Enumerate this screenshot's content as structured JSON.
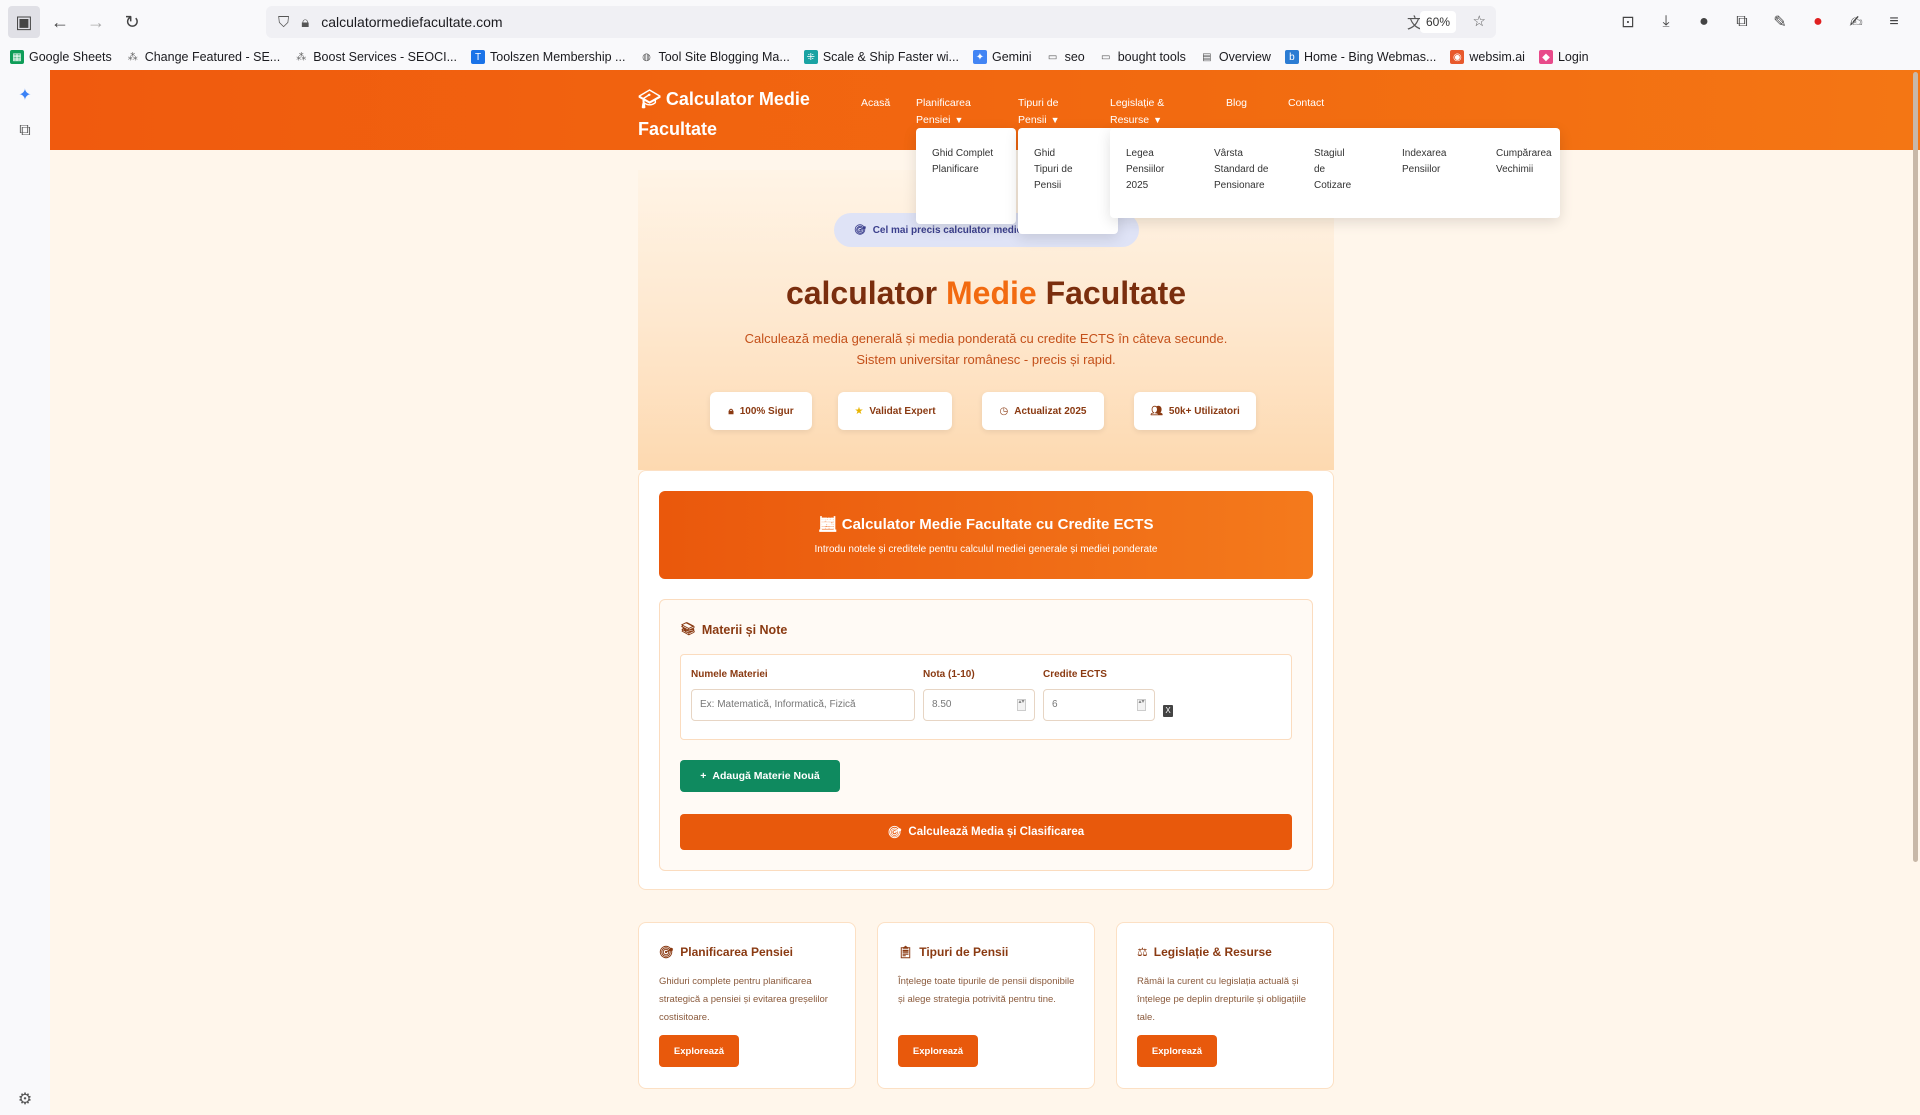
{
  "browser": {
    "url": "calculatormediefacultate.com",
    "zoom": "60%",
    "bookmarks": [
      {
        "label": "Google Sheets",
        "icon": "sheets-icon",
        "color": "#0f9d58"
      },
      {
        "label": "Change Featured - SE...",
        "icon": "network-icon",
        "color": "#666666"
      },
      {
        "label": "Boost Services - SEOCI...",
        "icon": "network-icon",
        "color": "#666666"
      },
      {
        "label": "Toolszen Membership ...",
        "icon": "toolszen-icon",
        "color": "#1a73e8"
      },
      {
        "label": "Tool Site Blogging Ma...",
        "icon": "globe-icon",
        "color": "#555555"
      },
      {
        "label": "Scale & Ship Faster wi...",
        "icon": "scale-icon",
        "color": "#1aa3a3"
      },
      {
        "label": "Gemini",
        "icon": "gemini-icon",
        "color": "#4285f4"
      },
      {
        "label": "seo",
        "icon": "folder-icon",
        "color": "#555555"
      },
      {
        "label": "bought tools",
        "icon": "folder-icon",
        "color": "#555555"
      },
      {
        "label": "Overview",
        "icon": "overview-icon",
        "color": "#555555"
      },
      {
        "label": "Home - Bing Webmas...",
        "icon": "bing-icon",
        "color": "#2b7cd3"
      },
      {
        "label": "websim.ai",
        "icon": "websim-icon",
        "color": "#e8592c"
      },
      {
        "label": "Login",
        "icon": "login-icon",
        "color": "#e84a8a"
      }
    ]
  },
  "site": {
    "logo": "Calculator Medie Facultate",
    "nav": [
      {
        "label": "Acasă",
        "has_caret": false
      },
      {
        "label": "Planificarea Pensiei",
        "has_caret": true
      },
      {
        "label": "Tipuri de Pensii",
        "has_caret": true
      },
      {
        "label": "Legislație & Resurse",
        "has_caret": true
      },
      {
        "label": "Blog",
        "has_caret": false
      },
      {
        "label": "Contact",
        "has_caret": false
      }
    ],
    "dropdowns": {
      "planificare": [
        "Ghid Complet Planificare"
      ],
      "tipuri": [
        "Ghid Tipuri de Pensii"
      ],
      "legislatie": [
        "Legea Pensiilor 2025",
        "Vârsta Standard de Pensionare",
        "Stagiul de Cotizare",
        "Indexarea Pensiilor",
        "Cumpărarea Vechimii"
      ]
    }
  },
  "hero": {
    "badge": "Cel mai precis calculator medie f",
    "title_part1": "calculator ",
    "title_accent": "Medie",
    "title_part2": " Facultate",
    "subtitle_line1": "Calculează media generală și media ponderată cu credite ECTS în câteva secunde.",
    "subtitle_line2": "Sistem universitar românesc - precis și rapid.",
    "pills": [
      "100% Sigur",
      "Validat Expert",
      "Actualizat 2025",
      "50k+ Utilizatori"
    ]
  },
  "calculator": {
    "title": "Calculator Medie Facultate cu Credite ECTS",
    "subtitle": "Introdu notele și creditele pentru calculul mediei generale și mediei ponderate",
    "subjects_title": "Materii și Note",
    "labels": {
      "name": "Numele Materiei",
      "grade": "Nota (1-10)",
      "credits": "Credite ECTS"
    },
    "placeholders": {
      "name": "Ex: Matematică, Informatică, Fizică",
      "grade": "8.50",
      "credits": "6"
    },
    "remove_label": "X",
    "add_button": "Adaugă Materie Nouă",
    "calc_button": "Calculează Media și Clasificarea"
  },
  "cards": [
    {
      "title": "Planificarea Pensiei",
      "text": "Ghiduri complete pentru planificarea strategică a pensiei și evitarea greșelilor costisitoare.",
      "button": "Explorează"
    },
    {
      "title": "Tipuri de Pensii",
      "text": "Înțelege toate tipurile de pensii disponibile și alege strategia potrivită pentru tine.",
      "button": "Explorează"
    },
    {
      "title": "Legislație & Resurse",
      "text": "Rămâi la curent cu legislația actuală și înțelege pe deplin drepturile și obligațiile tale.",
      "button": "Explorează"
    }
  ],
  "colors": {
    "brand": "#ea580c",
    "accent": "#f26a10",
    "green": "#0f8a5f",
    "dark_text": "#7a2e0e"
  }
}
